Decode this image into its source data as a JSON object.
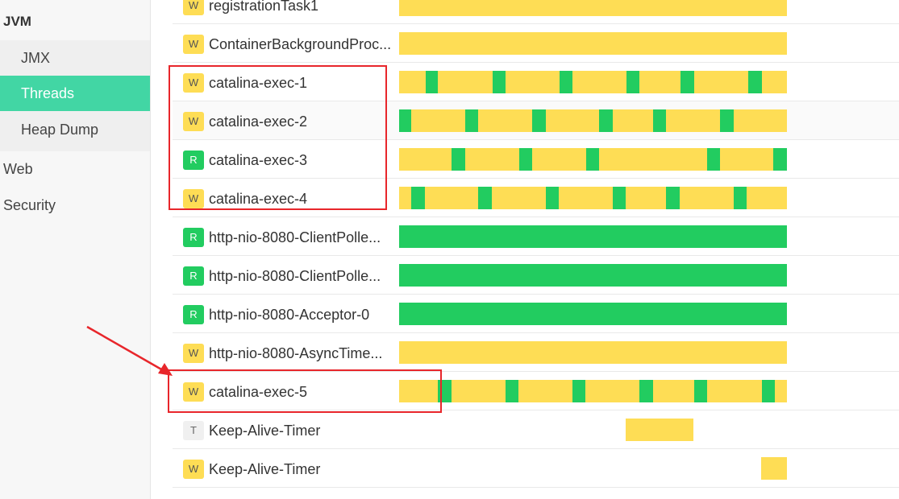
{
  "sidebar": {
    "group": "JVM",
    "items": [
      {
        "label": "JMX",
        "active": false
      },
      {
        "label": "Threads",
        "active": true
      },
      {
        "label": "Heap Dump",
        "active": false
      }
    ],
    "top_items": [
      {
        "label": "Web"
      },
      {
        "label": "Security"
      }
    ]
  },
  "colors": {
    "waiting": "#fedd55",
    "runnable": "#22cc60",
    "timed_waiting": "#fedd55",
    "active_nav": "#42d6a4",
    "annotation": "#e8262b"
  },
  "state_legend": {
    "W": "waiting",
    "R": "runnable",
    "T": "timed_waiting"
  },
  "threads": [
    {
      "state": "W",
      "name": "registrationTask1",
      "segments": [
        [
          "W",
          0.0,
          1.0
        ]
      ]
    },
    {
      "state": "W",
      "name": "ContainerBackgroundProc...",
      "segments": [
        [
          "W",
          0.0,
          1.0
        ]
      ]
    },
    {
      "state": "W",
      "name": "catalina-exec-1",
      "segments": [
        [
          "W",
          0,
          0.068
        ],
        [
          "R",
          0.068,
          0.1
        ],
        [
          "W",
          0.1,
          0.241
        ],
        [
          "R",
          0.241,
          0.274
        ],
        [
          "W",
          0.274,
          0.414
        ],
        [
          "R",
          0.414,
          0.447
        ],
        [
          "W",
          0.447,
          0.587
        ],
        [
          "R",
          0.587,
          0.62
        ],
        [
          "W",
          0.62,
          0.726
        ],
        [
          "R",
          0.726,
          0.76
        ],
        [
          "W",
          0.76,
          0.9
        ],
        [
          "R",
          0.9,
          0.935
        ],
        [
          "W",
          0.935,
          1.0
        ]
      ]
    },
    {
      "state": "W",
      "name": "catalina-exec-2",
      "segments": [
        [
          "R",
          0,
          0.031
        ],
        [
          "W",
          0.031,
          0.171
        ],
        [
          "R",
          0.171,
          0.204
        ],
        [
          "W",
          0.204,
          0.343
        ],
        [
          "R",
          0.343,
          0.378
        ],
        [
          "W",
          0.378,
          0.516
        ],
        [
          "R",
          0.516,
          0.55
        ],
        [
          "W",
          0.55,
          0.655
        ],
        [
          "R",
          0.655,
          0.688
        ],
        [
          "W",
          0.688,
          0.828
        ],
        [
          "R",
          0.828,
          0.863
        ],
        [
          "W",
          0.863,
          1.0
        ]
      ]
    },
    {
      "state": "R",
      "name": "catalina-exec-3",
      "segments": [
        [
          "W",
          0,
          0.135
        ],
        [
          "R",
          0.135,
          0.17
        ],
        [
          "W",
          0.17,
          0.31
        ],
        [
          "R",
          0.31,
          0.343
        ],
        [
          "W",
          0.343,
          0.482
        ],
        [
          "R",
          0.482,
          0.516
        ],
        [
          "W",
          0.516,
          0.794
        ],
        [
          "R",
          0.794,
          0.828
        ],
        [
          "W",
          0.828,
          0.965
        ],
        [
          "R",
          0.965,
          1.0
        ]
      ]
    },
    {
      "state": "W",
      "name": "catalina-exec-4",
      "segments": [
        [
          "W",
          0,
          0.031
        ],
        [
          "R",
          0.031,
          0.067
        ],
        [
          "W",
          0.067,
          0.204
        ],
        [
          "R",
          0.204,
          0.239
        ],
        [
          "W",
          0.239,
          0.378
        ],
        [
          "R",
          0.378,
          0.412
        ],
        [
          "W",
          0.412,
          0.55
        ],
        [
          "R",
          0.55,
          0.585
        ],
        [
          "W",
          0.585,
          0.689
        ],
        [
          "R",
          0.689,
          0.723
        ],
        [
          "W",
          0.723,
          0.862
        ],
        [
          "R",
          0.862,
          0.896
        ],
        [
          "W",
          0.896,
          1.0
        ]
      ]
    },
    {
      "state": "R",
      "name": "http-nio-8080-ClientPolle...",
      "segments": [
        [
          "R",
          0.0,
          1.0
        ]
      ]
    },
    {
      "state": "R",
      "name": "http-nio-8080-ClientPolle...",
      "segments": [
        [
          "R",
          0.0,
          1.0
        ]
      ]
    },
    {
      "state": "R",
      "name": "http-nio-8080-Acceptor-0",
      "segments": [
        [
          "R",
          0.0,
          1.0
        ]
      ]
    },
    {
      "state": "W",
      "name": "http-nio-8080-AsyncTime...",
      "segments": [
        [
          "W",
          0.0,
          1.0
        ]
      ]
    },
    {
      "state": "W",
      "name": "catalina-exec-5",
      "segments": [
        [
          "W",
          0,
          0.1
        ],
        [
          "R",
          0.1,
          0.135
        ],
        [
          "W",
          0.135,
          0.274
        ],
        [
          "R",
          0.274,
          0.308
        ],
        [
          "W",
          0.308,
          0.447
        ],
        [
          "R",
          0.447,
          0.481
        ],
        [
          "W",
          0.481,
          0.62
        ],
        [
          "R",
          0.62,
          0.655
        ],
        [
          "W",
          0.655,
          0.76
        ],
        [
          "R",
          0.76,
          0.795
        ],
        [
          "W",
          0.795,
          0.935
        ],
        [
          "R",
          0.935,
          0.968
        ],
        [
          "W",
          0.968,
          1.0
        ]
      ]
    },
    {
      "state": "T",
      "name": "Keep-Alive-Timer",
      "segments": [
        [
          "W",
          0.585,
          0.758
        ]
      ]
    },
    {
      "state": "W",
      "name": "Keep-Alive-Timer",
      "segments": [
        [
          "W",
          0.933,
          1.0
        ]
      ]
    }
  ]
}
